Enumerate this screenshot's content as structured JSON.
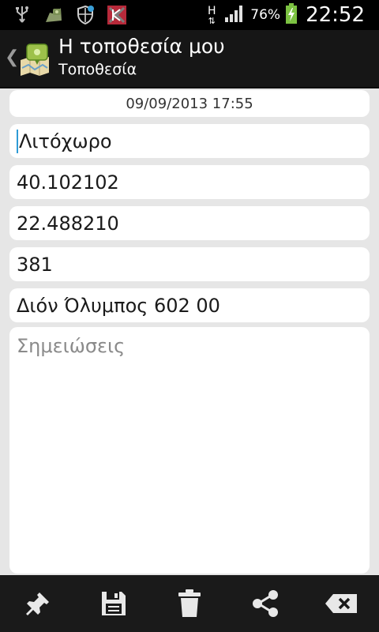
{
  "status_bar": {
    "network_type": "H",
    "battery_percent": "76%",
    "time": "22:52",
    "icons": [
      "usb-icon",
      "app-notification-icon",
      "shield-icon",
      "kaspersky-icon",
      "signal-icon",
      "battery-charging-icon"
    ]
  },
  "action_bar": {
    "title": "Η τοποθεσία μου",
    "subtitle": "Τοποθεσία",
    "up_icon": "chevron-left-icon",
    "app_icon": "map-location-icon"
  },
  "form": {
    "datetime": "09/09/2013 17:55",
    "name": "Λιτόχωρο",
    "latitude": "40.102102",
    "longitude": "22.488210",
    "altitude": "381",
    "address": "Διόν Όλυμπος 602 00",
    "notes_placeholder": "Σημειώσεις"
  },
  "bottom_bar": {
    "buttons": [
      "pin-icon",
      "save-icon",
      "trash-icon",
      "share-icon",
      "backspace-icon"
    ]
  }
}
